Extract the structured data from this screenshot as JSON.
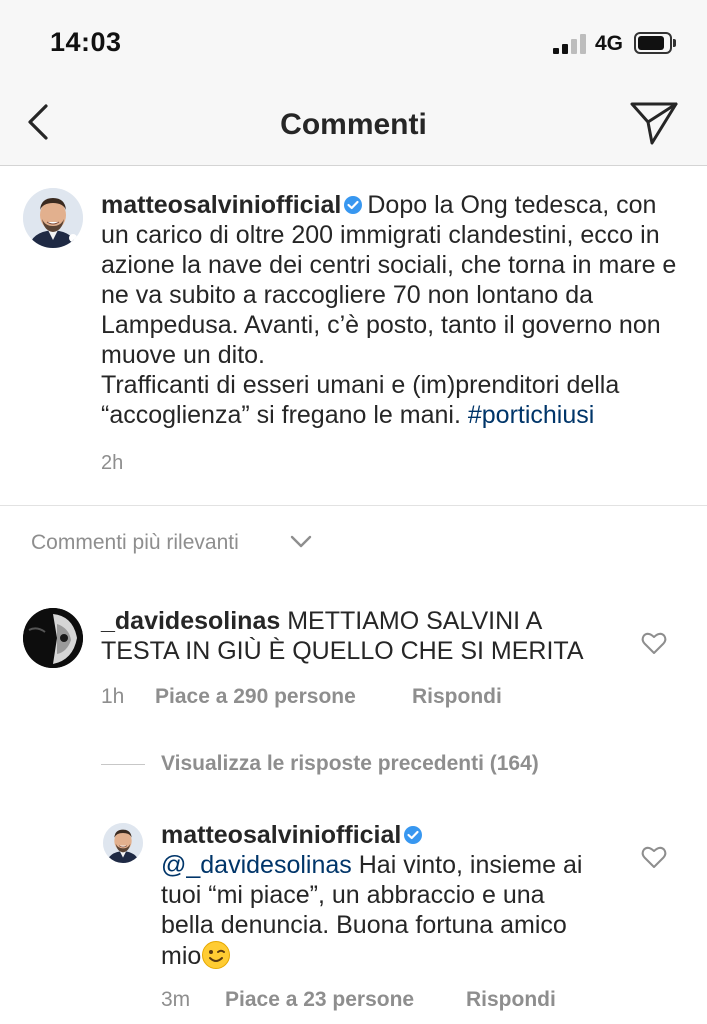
{
  "status_bar": {
    "time": "14:03",
    "network": "4G",
    "icons": [
      "signal-icon",
      "battery-icon"
    ]
  },
  "header": {
    "title": "Commenti",
    "icons": [
      "back-chevron-icon",
      "send-icon"
    ]
  },
  "caption": {
    "username": "matteosalviniofficial",
    "verified": true,
    "text": "Dopo la Ong tedesca, con un carico di oltre 200 immigrati clandestini, ecco in azione la nave dei centri sociali, che torna in mare e ne va subito a raccogliere 70 non lontano da Lampedusa. Avanti, c’è posto, tanto il governo non muove un dito.",
    "text_2": "Trafficanti di esseri umani e (im)prenditori della “accoglienza” si fregano le mani.",
    "hashtag": "#portichiusi",
    "time": "2h"
  },
  "sort": {
    "label": "Commenti più rilevanti"
  },
  "comments": [
    {
      "username": "_davidesolinas",
      "text": "METTIAMO SALVINI A TESTA IN GIÙ È QUELLO CHE SI MERITA",
      "time": "1h",
      "likes": "Piace a 290 persone",
      "reply": "Rispondi",
      "view_replies": "Visualizza le risposte precedenti (164)"
    }
  ],
  "reply": {
    "username": "matteosalviniofficial",
    "verified": true,
    "mention": "@_davidesolinas",
    "text": "Hai vinto, insieme ai tuoi “mi piace”, un abbraccio e una bella denuncia. Buona fortuna amico mio",
    "emoji": "winking-face-emoji",
    "time": "3m",
    "likes": "Piace a 23 persone",
    "reply_label": "Rispondi"
  },
  "colors": {
    "text": "#262626",
    "secondary": "#8e8e8e",
    "link": "#003569",
    "verified": "#3897f0",
    "bar_bg": "#f7f7f7"
  }
}
